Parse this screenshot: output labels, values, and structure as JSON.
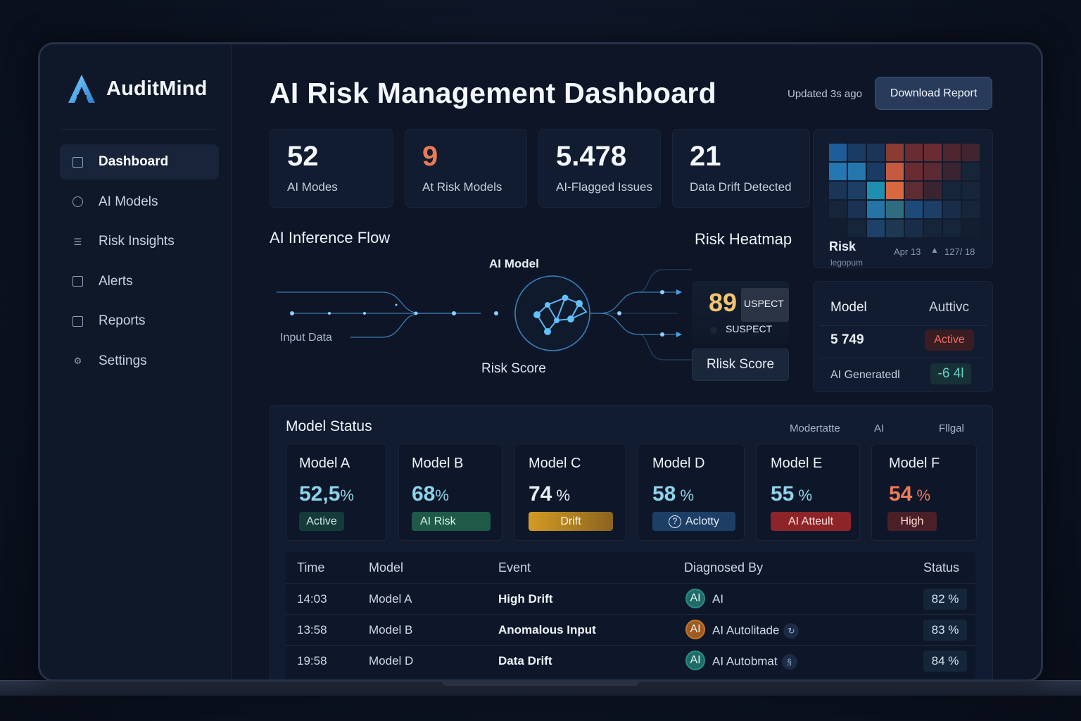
{
  "app": {
    "name": "AuditMind"
  },
  "sidebar": {
    "items": [
      {
        "label": "Dashboard",
        "icon": "dashboard-icon",
        "active": true
      },
      {
        "label": "AI Models",
        "icon": "info-icon"
      },
      {
        "label": "Risk Insights",
        "icon": "list-icon"
      },
      {
        "label": "Alerts",
        "icon": "bell-icon"
      },
      {
        "label": "Reports",
        "icon": "report-icon"
      },
      {
        "label": "Settings",
        "icon": "gear-icon"
      }
    ]
  },
  "header": {
    "title": "AI Risk Management Dashboard",
    "updated": "Updated 3s ago",
    "download_label": "Download Report"
  },
  "kpis": [
    {
      "value": "52",
      "label": "AI Modes"
    },
    {
      "value": "9",
      "label": "At Risk Models",
      "color": "#ea7a55"
    },
    {
      "value": "5.478",
      "label": "AI-Flagged Issues"
    },
    {
      "value": "21",
      "label": "Data Drift Detected"
    }
  ],
  "heatmap_card": {
    "title": "Risk",
    "subtitle": "legopum",
    "date": "Apr 13",
    "count": "127/ 18",
    "colors": [
      "#1d5c98",
      "#1a3b63",
      "#1b3558",
      "#8a3b32",
      "#6b2c31",
      "#6b2c31",
      "#4f2630",
      "#3f2530",
      "#2577b1",
      "#2576ad",
      "#1a3b63",
      "#c65a3e",
      "#6b2c31",
      "#5b2a32",
      "#3a2430",
      "#172538",
      "#1a3558",
      "#1d3f66",
      "#1f8fb0",
      "#d8683f",
      "#5e2c32",
      "#3a2430",
      "#172538",
      "#172538",
      "#172538",
      "#1a3253",
      "#2574a5",
      "#2f6c80",
      "#1d4a78",
      "#1d3f66",
      "#1a2d48",
      "#172538",
      "#121d30",
      "#172538",
      "#1d4168",
      "#1f3852",
      "#1a2d48",
      "#172538",
      "#172538",
      "#131e31"
    ]
  },
  "inference": {
    "title": "AI Inference Flow",
    "model_label": "AI Model",
    "input_label": "Input Data",
    "output_label": "Risk Score"
  },
  "risk_heatmap": {
    "title": "Risk Heatmap",
    "score": "89",
    "tag": "USPECT",
    "sub": "SUSPECT",
    "button": "Rlisk Score"
  },
  "model_card": {
    "head_left": "Model",
    "head_right": "Auttivc",
    "row1_value": "5 749",
    "row1_pill": "Active",
    "row2_label": "AI Generatedl",
    "row2_value": "-6 4l"
  },
  "model_status": {
    "title": "Model Status",
    "tabs": [
      "Modertatte",
      "AI",
      "Fllgal"
    ],
    "models": [
      {
        "name": "Model A",
        "pct": "52,5",
        "unit": "%",
        "badge": "Active",
        "pct_color": "#8fd3e8",
        "badge_bg": "#153a3a",
        "badge_fg": "#cde7e2"
      },
      {
        "name": "Model B",
        "pct": "68",
        "unit": "%",
        "badge": "AI Risk",
        "pct_color": "#8fd3e8",
        "badge_bg": "#1f5a48",
        "badge_fg": "#d7efe6"
      },
      {
        "name": "Model C",
        "pct": "74",
        "unit": " %",
        "badge": "Drift",
        "pct_color": "#e8edf5",
        "badge_bg": "#c9901d",
        "badge_fg": "#fff7e6"
      },
      {
        "name": "Model D",
        "pct": "58",
        "unit": " %",
        "badge": "Aclotty",
        "pct_color": "#8fd3e8",
        "badge_bg": "#1d3f66",
        "badge_fg": "#e3ecf7"
      },
      {
        "name": "Model E",
        "pct": "55",
        "unit": " %",
        "badge": "AI Atteult",
        "pct_color": "#8fd3e8",
        "badge_bg": "#8d2428",
        "badge_fg": "#ffe3e1"
      },
      {
        "name": "Model F",
        "pct": "54",
        "unit": " %",
        "badge": "High",
        "pct_color": "#ef7a58",
        "badge_bg": "#4a1f27",
        "badge_fg": "#ffd9d3"
      }
    ]
  },
  "events": {
    "headers": [
      "Time",
      "Model",
      "Event",
      "Diagnosed By",
      "Status"
    ],
    "rows": [
      {
        "time": "14:03",
        "model": "Model A",
        "event": "High Drift",
        "badge": "AI",
        "badge_color": "#1e6b67",
        "by": "AI",
        "status": "82 %"
      },
      {
        "time": "13:58",
        "model": "Model B",
        "event": "Anomalous Input",
        "badge": "AI",
        "badge_color": "#a05a1e",
        "by": "AI Autolitade",
        "status": "83 %"
      },
      {
        "time": "19:58",
        "model": "Model D",
        "event": "Data Drift",
        "badge": "AI",
        "badge_color": "#1e6b67",
        "by": "AI Autobmat",
        "status": "84 %"
      }
    ]
  }
}
